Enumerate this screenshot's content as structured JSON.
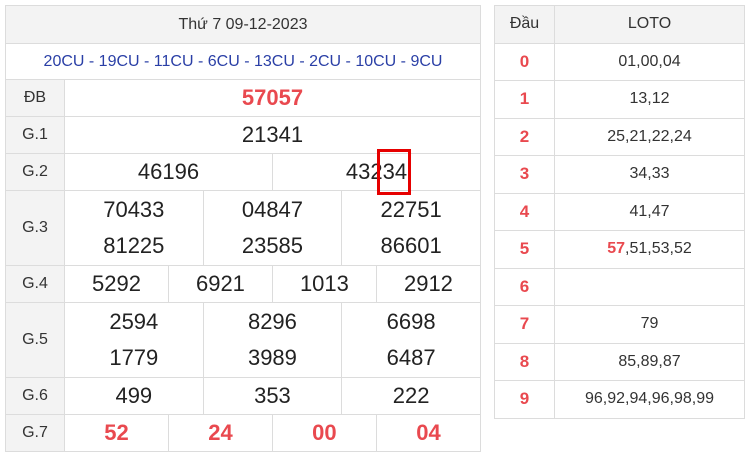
{
  "header": {
    "date": "Thứ 7 09-12-2023",
    "codes": "20CU - 19CU - 11CU - 6CU - 13CU - 2CU - 10CU - 9CU"
  },
  "prizes": {
    "db": {
      "label": "ĐB",
      "value": "57057"
    },
    "g1": {
      "label": "G.1",
      "values": [
        "21341"
      ]
    },
    "g2": {
      "label": "G.2",
      "values": [
        "46196",
        "43234"
      ],
      "highlight_prefix": "432",
      "highlight_suffix": "34"
    },
    "g3": {
      "label": "G.3",
      "values": [
        "70433",
        "04847",
        "22751",
        "81225",
        "23585",
        "86601"
      ]
    },
    "g4": {
      "label": "G.4",
      "values": [
        "5292",
        "6921",
        "1013",
        "2912"
      ]
    },
    "g5": {
      "label": "G.5",
      "values": [
        "2594",
        "8296",
        "6698",
        "1779",
        "3989",
        "6487"
      ]
    },
    "g6": {
      "label": "G.6",
      "values": [
        "499",
        "353",
        "222"
      ]
    },
    "g7": {
      "label": "G.7",
      "values": [
        "52",
        "24",
        "00",
        "04"
      ]
    }
  },
  "loto": {
    "headers": [
      "Đầu",
      "LOTO"
    ],
    "rows": [
      {
        "head": "0",
        "value": "01,00,04"
      },
      {
        "head": "1",
        "value": "13,12"
      },
      {
        "head": "2",
        "value": "25,21,22,24"
      },
      {
        "head": "3",
        "value": "34,33"
      },
      {
        "head": "4",
        "value": "41,47"
      },
      {
        "head": "5",
        "value_red": "57",
        "value": ",51,53,52"
      },
      {
        "head": "6",
        "value": ""
      },
      {
        "head": "7",
        "value": "79"
      },
      {
        "head": "8",
        "value": "85,89,87"
      },
      {
        "head": "9",
        "value": "96,92,94,96,98,99"
      }
    ]
  },
  "colors": {
    "accent_red": "#e9494f",
    "code_blue": "#2a3fa6",
    "highlight_box": "#e60000"
  }
}
